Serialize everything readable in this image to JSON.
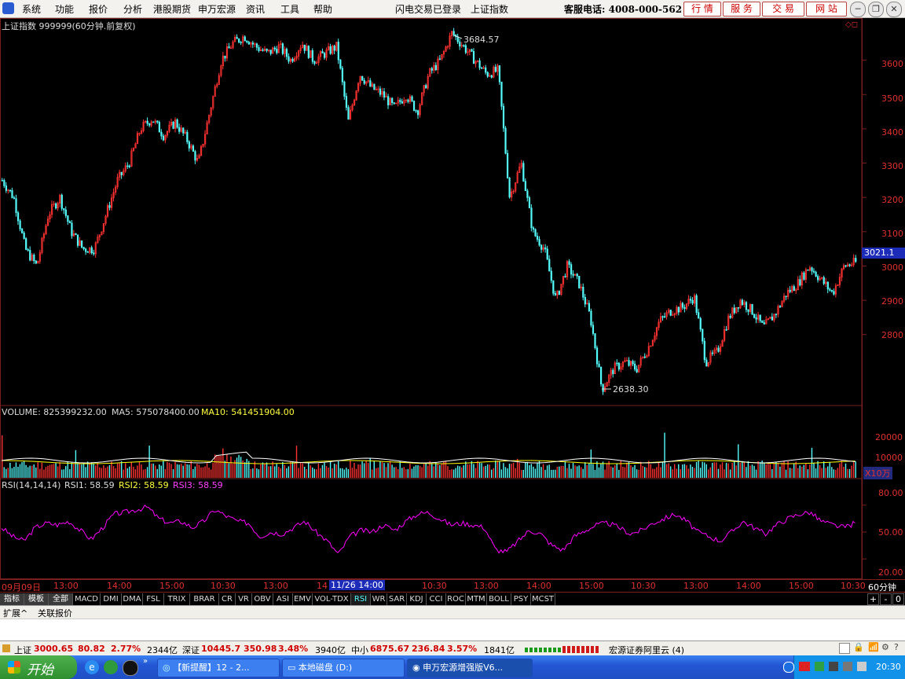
{
  "menu": {
    "app_icon": "app-logo-icon",
    "items": [
      "系统",
      "功能",
      "报价",
      "分析",
      "港股期货",
      "申万宏源",
      "资讯",
      "工具",
      "帮助"
    ],
    "status_login": "闪电交易已登录",
    "status_index": "上证指数",
    "hotline": "客服电话: 4008-000-562",
    "nav_buttons": [
      "行 情",
      "服 务",
      "交 易",
      "网 站"
    ]
  },
  "chart_header": {
    "title": "上证指数 999999(60分钟.前复权)",
    "high_label": "3684.57",
    "low_label": "2638.30",
    "current_price": "3021.1"
  },
  "price_axis": [
    "3600",
    "3500",
    "3400",
    "3300",
    "3200",
    "3100",
    "3000",
    "2900",
    "2800"
  ],
  "volume_header": {
    "volume": "VOLUME: 825399232.00",
    "ma5": "MA5: 575078400.00",
    "ma10": "MA10: 541451904.00"
  },
  "volume_axis": [
    "20000",
    "10000"
  ],
  "volume_unit": "X10万",
  "rsi_header": {
    "name": "RSI(14,14,14)",
    "rsi1": "RSI1: 58.59",
    "rsi2": "RSI2: 58.59",
    "rsi3": "RSI3: 58.59"
  },
  "rsi_axis": [
    "80.00",
    "50.00",
    "20.00"
  ],
  "time_axis": {
    "labels": [
      "09月09日",
      "13:00",
      "14:00",
      "15:00",
      "10:30",
      "13:00",
      "14",
      "10:30",
      "13:00",
      "14:00",
      "15:00",
      "10:30",
      "13:00",
      "14:00",
      "15:00",
      "10:30"
    ],
    "highlight": "11/26 14:00",
    "period": "60分钟"
  },
  "indicator_tabs": [
    "指标",
    "模板",
    "全部",
    "MACD",
    "DMI",
    "DMA",
    "FSL",
    "TRIX",
    "BRAR",
    "CR",
    "VR",
    "OBV",
    "ASI",
    "EMV",
    "VOL-TDX",
    "RSI",
    "WR",
    "SAR",
    "KDJ",
    "CCI",
    "ROC",
    "MTM",
    "BOLL",
    "PSY",
    "MCST"
  ],
  "right_controls": [
    "+",
    "-",
    "0"
  ],
  "lower_tabs": [
    "扩展^",
    "关联报价"
  ],
  "status_bar": {
    "sh": {
      "name": "上证",
      "price": "3000.65",
      "chg": "80.82",
      "pct": "2.77%",
      "amt": "2344亿"
    },
    "sz": {
      "name": "深证",
      "price": "10445.7",
      "chg": "350.98",
      "pct": "3.48%",
      "amt": "3940亿"
    },
    "zx": {
      "name": "中小",
      "price": "6875.67",
      "chg": "236.84",
      "pct": "3.57%",
      "amt": "1841亿"
    },
    "broker": "宏源证券阿里云 (4)"
  },
  "taskbar": {
    "start": "开始",
    "windows": [
      "【新提醒】12 - 2...",
      "本地磁盘 (D:)",
      "申万宏源增强版V6..."
    ],
    "clock": "20:30"
  },
  "colors": {
    "up": "#ff3232",
    "down": "#54fcfc",
    "rsi": "#ff00ff",
    "ma5": "#ffffff",
    "ma10": "#ffff00",
    "grid": "#7a1f1f"
  },
  "chart_data": {
    "type": "candlestick",
    "ylim": [
      2600,
      3700
    ],
    "price_path": [
      3250,
      3200,
      3050,
      3000,
      3150,
      3200,
      3100,
      3050,
      3050,
      3150,
      3250,
      3300,
      3400,
      3430,
      3380,
      3420,
      3370,
      3300,
      3450,
      3600,
      3650,
      3670,
      3640,
      3620,
      3640,
      3600,
      3650,
      3600,
      3620,
      3640,
      3420,
      3560,
      3520,
      3500,
      3460,
      3500,
      3450,
      3560,
      3600,
      3680,
      3640,
      3600,
      3560,
      3570,
      3200,
      3300,
      3100,
      3050,
      2900,
      3000,
      2950,
      2850,
      2640,
      2700,
      2720,
      2700,
      2760,
      2840,
      2870,
      2880,
      2910,
      2720,
      2750,
      2850,
      2900,
      2870,
      2820,
      2860,
      2920,
      2950,
      3000,
      2960,
      2920,
      3000,
      3010
    ],
    "rsi_path": [
      55,
      45,
      40,
      55,
      60,
      58,
      62,
      52,
      42,
      55,
      70,
      72,
      75,
      78,
      65,
      60,
      62,
      55,
      62,
      75,
      68,
      62,
      60,
      45,
      50,
      48,
      55,
      62,
      50,
      40,
      25,
      45,
      52,
      50,
      58,
      52,
      62,
      70,
      72,
      65,
      58,
      60,
      58,
      55,
      30,
      28,
      40,
      52,
      48,
      35,
      30,
      45,
      52,
      58,
      60,
      55,
      48,
      52,
      60,
      65,
      70,
      62,
      50,
      45,
      40,
      50,
      62,
      55,
      48,
      58,
      65,
      70,
      72,
      62,
      58,
      55,
      60
    ]
  }
}
